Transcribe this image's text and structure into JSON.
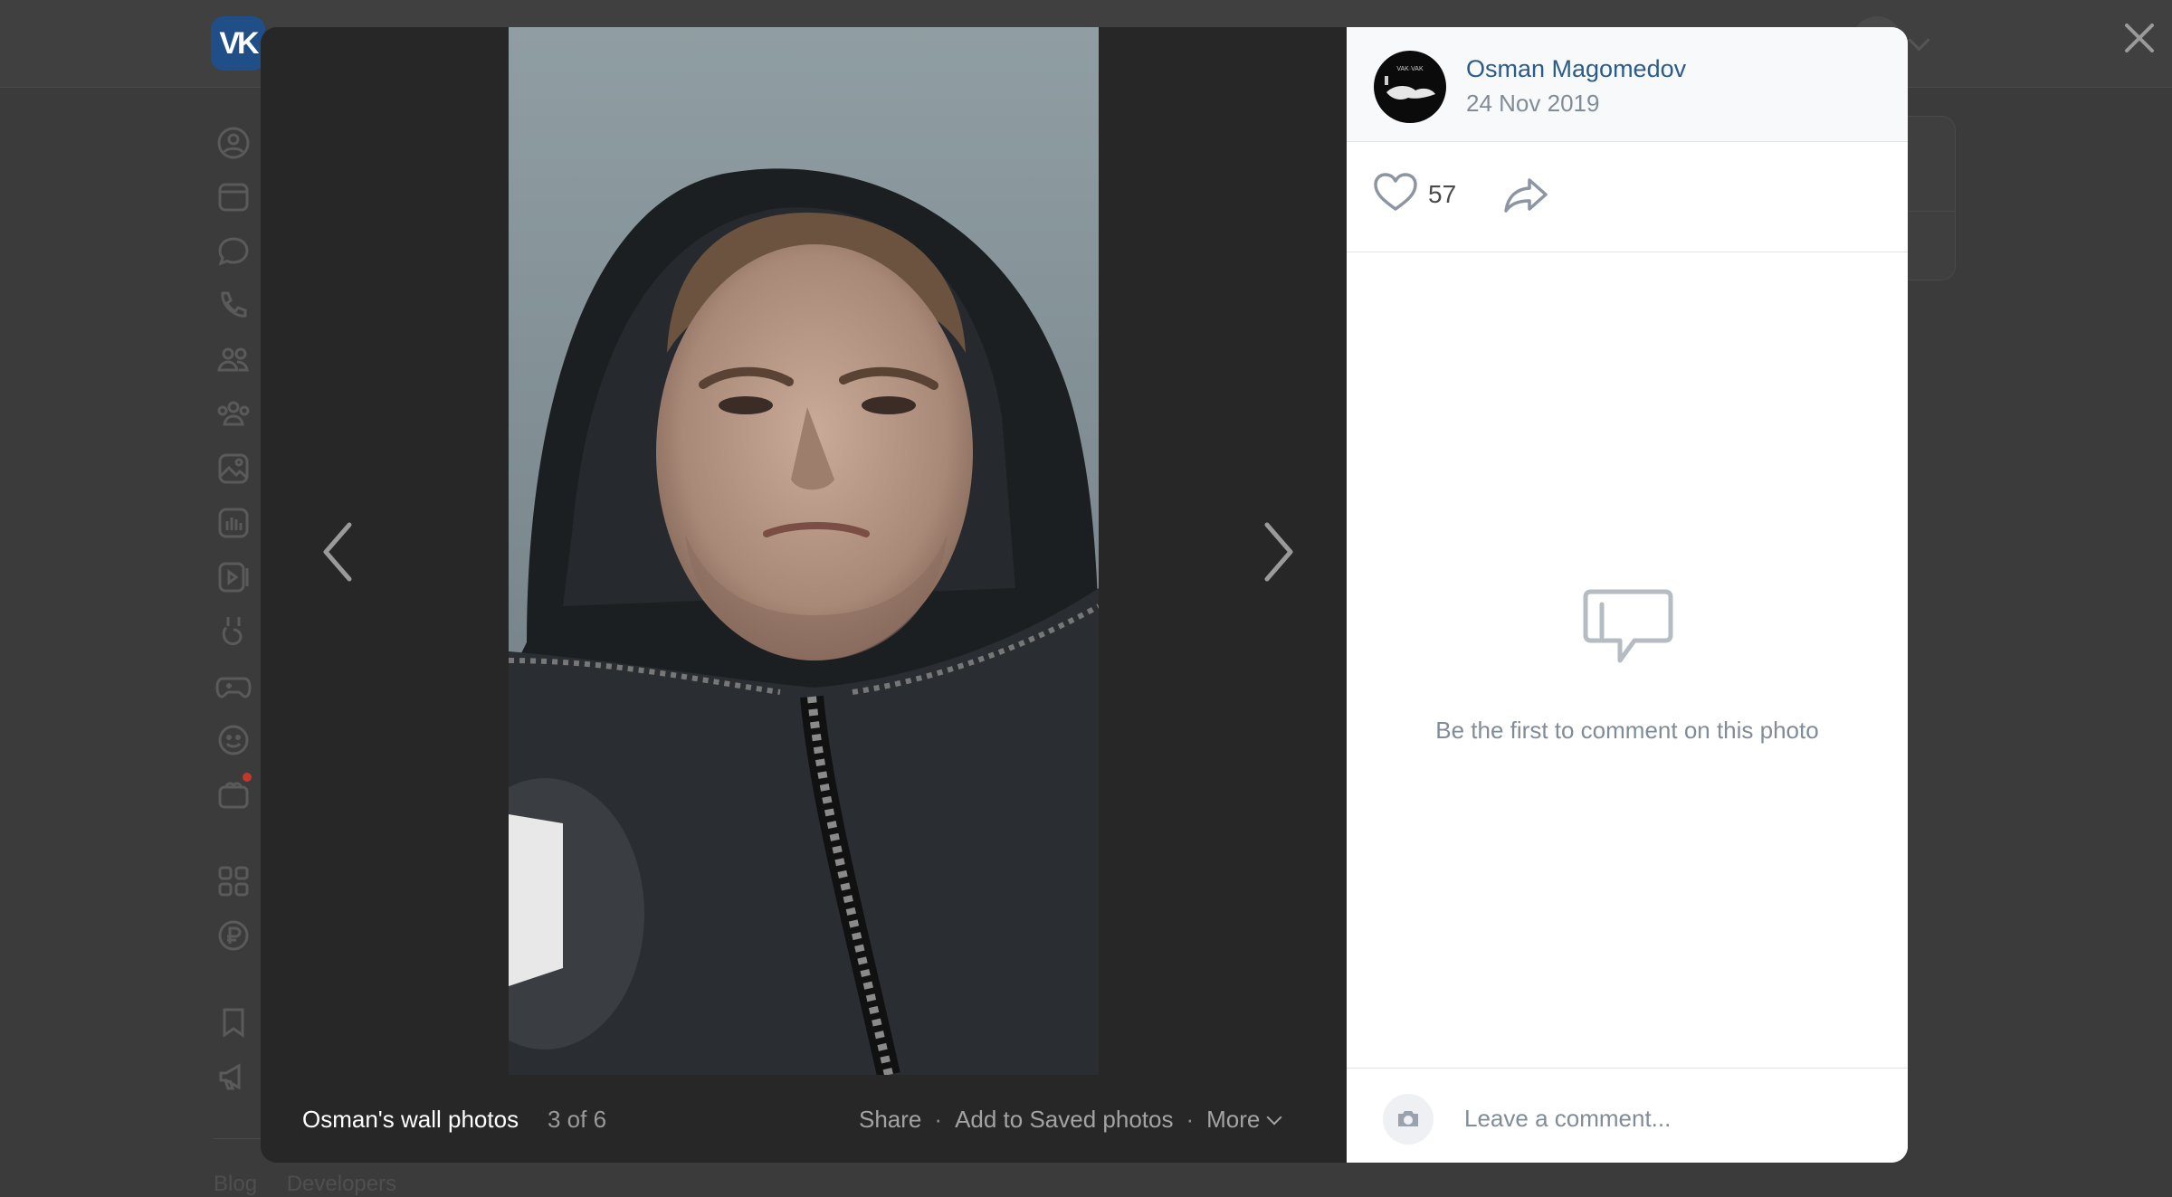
{
  "app": {
    "logo_text": "VK"
  },
  "footer": {
    "links": [
      "Blog",
      "Developers"
    ]
  },
  "left_nav": {
    "icons": [
      "profile-icon",
      "news-icon",
      "messenger-icon",
      "calls-icon",
      "friends-icon",
      "communities-icon",
      "photos-icon",
      "music-icon",
      "video-icon",
      "clips-icon",
      "games-icon",
      "stickers-icon",
      "gifts-icon",
      "services-icon",
      "payments-icon",
      "bookmarks-icon",
      "ads-icon"
    ]
  },
  "viewer": {
    "album_title": "Osman's wall photos",
    "counter": "3 of 6",
    "actions": {
      "share": "Share",
      "save": "Add to Saved photos",
      "more": "More",
      "separator": "·"
    },
    "photo_alt": "Selfie of a young man wearing a black hooded jacket"
  },
  "post": {
    "author": "Osman Magomedov",
    "date": "24 Nov 2019",
    "likes": "57",
    "avatar_text": "VAK·VAK"
  },
  "comments": {
    "empty_text": "Be the first to comment on this photo",
    "placeholder": "Leave a comment..."
  },
  "colors": {
    "link": "#2c5a8a",
    "secondary": "#818c99",
    "overlay": "#3b3b3b",
    "viewer_bg": "#282828"
  }
}
